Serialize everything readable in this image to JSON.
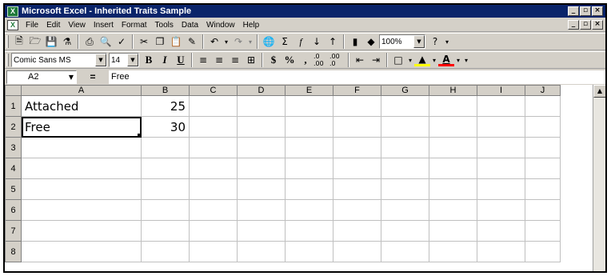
{
  "window": {
    "title": "Microsoft Excel - Inherited Traits Sample",
    "app_icon": "excel-icon",
    "controls": [
      "_",
      "&#9643;",
      "×"
    ]
  },
  "menu": {
    "items": [
      {
        "label": "File"
      },
      {
        "label": "Edit"
      },
      {
        "label": "View"
      },
      {
        "label": "Insert"
      },
      {
        "label": "Format"
      },
      {
        "label": "Tools"
      },
      {
        "label": "Data"
      },
      {
        "label": "Window"
      },
      {
        "label": "Help"
      }
    ]
  },
  "toolbar_standard": {
    "zoom": "100%",
    "icons": [
      "new-icon",
      "open-icon",
      "save-icon",
      "permission-icon",
      "print-icon",
      "print-preview-icon",
      "spelling-icon",
      "cut-icon",
      "copy-icon",
      "paste-icon",
      "format-painter-icon",
      "undo-icon",
      "redo-icon",
      "hyperlink-icon",
      "autosum-icon",
      "function-icon",
      "sort-ascending-icon",
      "sort-descending-icon",
      "chart-wizard-icon",
      "drawing-icon",
      "help-icon"
    ]
  },
  "toolbar_format": {
    "font_name": "Comic Sans MS",
    "font_size": "14",
    "bold": "B",
    "italic": "I",
    "underline": "U",
    "currency": "$",
    "percent": "%",
    "comma": ",",
    "increase_decimal": ".0 .00",
    "decrease_decimal": ".00 .0",
    "font_color_letter": "A",
    "fill_color": "#ffff00",
    "font_color": "#ff0000"
  },
  "formula_bar": {
    "name_box": "A2",
    "equals": "=",
    "content": "Free"
  },
  "sheet": {
    "columns": [
      "A",
      "B",
      "C",
      "D",
      "E",
      "F",
      "G",
      "H",
      "I",
      "J"
    ],
    "rows": [
      {
        "num": "1",
        "a": "Attached",
        "b": "25"
      },
      {
        "num": "2",
        "a": "Free",
        "b": "30"
      },
      {
        "num": "3",
        "a": "",
        "b": ""
      },
      {
        "num": "4",
        "a": "",
        "b": ""
      },
      {
        "num": "5",
        "a": "",
        "b": ""
      },
      {
        "num": "6",
        "a": "",
        "b": ""
      },
      {
        "num": "7",
        "a": "",
        "b": ""
      },
      {
        "num": "8",
        "a": "",
        "b": ""
      }
    ],
    "selected_cell": "A2"
  }
}
